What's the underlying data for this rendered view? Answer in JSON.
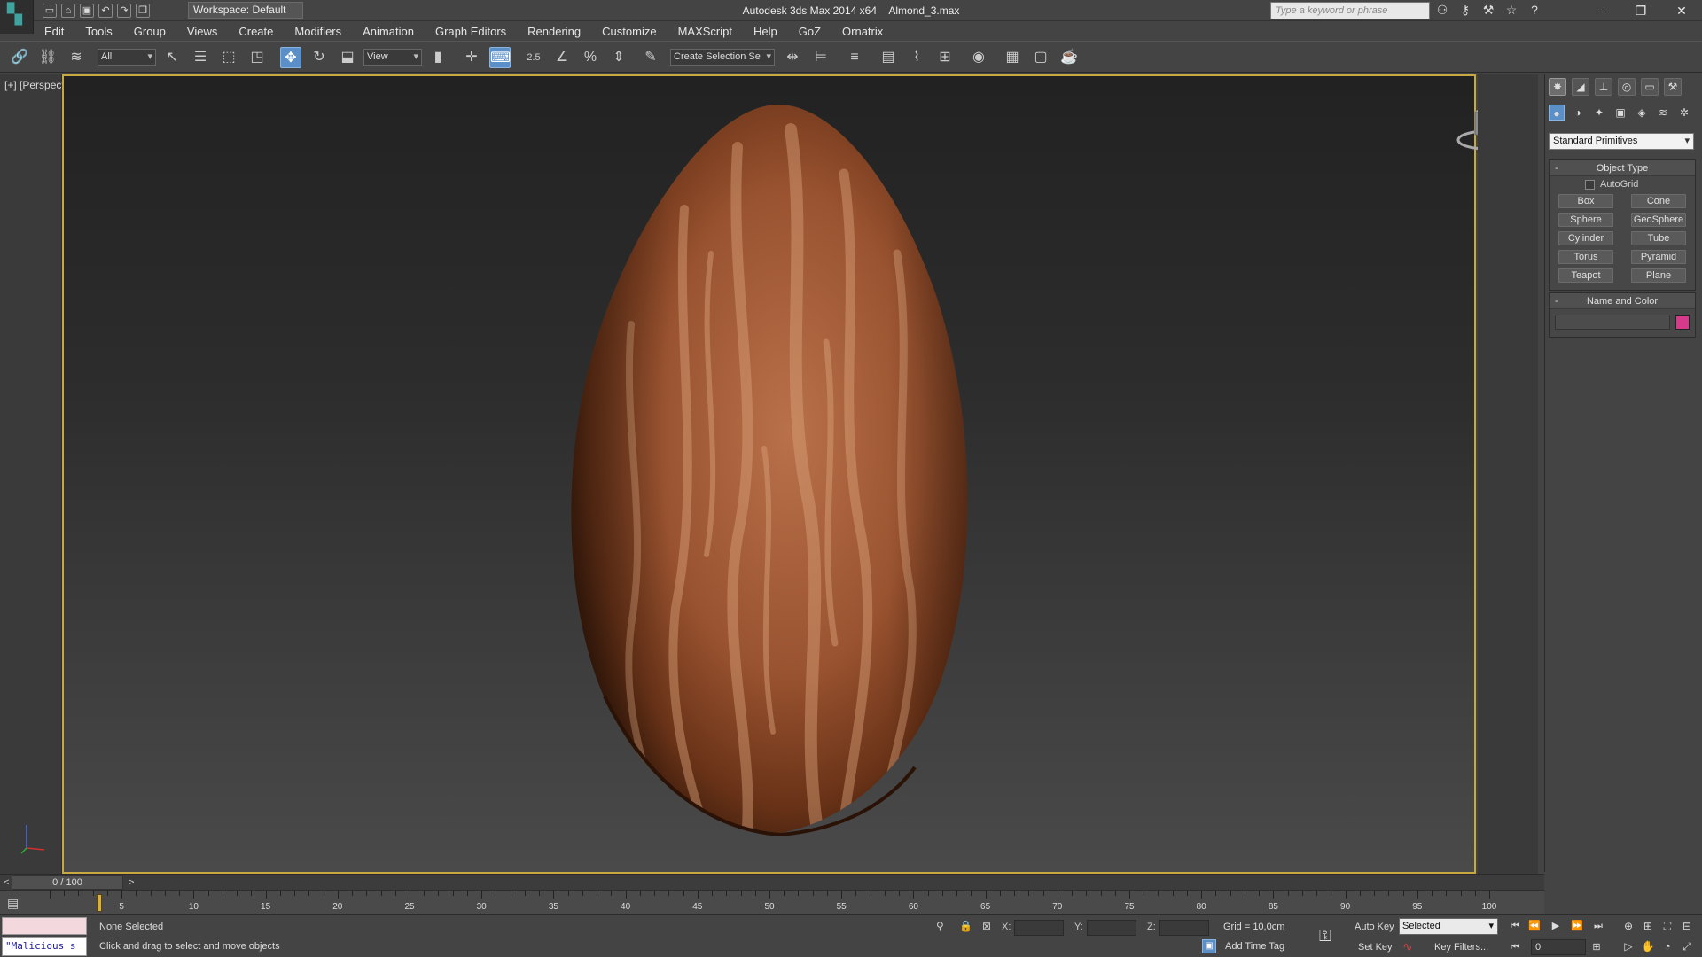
{
  "app": {
    "title": "Autodesk 3ds Max  2014 x64",
    "file": "Almond_3.max",
    "workspace": "Workspace: Default",
    "search_placeholder": "Type a keyword or phrase"
  },
  "menu": [
    "Edit",
    "Tools",
    "Group",
    "Views",
    "Create",
    "Modifiers",
    "Animation",
    "Graph Editors",
    "Rendering",
    "Customize",
    "MAXScript",
    "Help",
    "GoZ",
    "Ornatrix"
  ],
  "toolbar": {
    "filter": "All",
    "ref_coord": "View",
    "snap_label": "2.5",
    "named_selection": "Create Selection Se"
  },
  "viewport": {
    "label": "[+] [Perspective ] [Shaded]"
  },
  "command_panel": {
    "category": "Standard Primitives",
    "object_type_title": "Object Type",
    "autogrid_label": "AutoGrid",
    "primitives": [
      "Box",
      "Cone",
      "Sphere",
      "GeoSphere",
      "Cylinder",
      "Tube",
      "Torus",
      "Pyramid",
      "Teapot",
      "Plane"
    ],
    "name_color_title": "Name and Color",
    "object_color": "#d63a8a"
  },
  "timeline": {
    "slider": "0 / 100",
    "prev": "<",
    "next": ">",
    "labels": [
      "5",
      "10",
      "15",
      "20",
      "25",
      "30",
      "35",
      "40",
      "45",
      "50",
      "55",
      "60",
      "65",
      "70",
      "75",
      "80",
      "85",
      "90",
      "95",
      "100"
    ]
  },
  "status": {
    "maxscript_text": "\"Malicious s",
    "selection": "None Selected",
    "prompt": "Click and drag to select and move objects",
    "x_label": "X:",
    "y_label": "Y:",
    "z_label": "Z:",
    "grid": "Grid = 10,0cm",
    "add_time_tag": "Add Time Tag",
    "auto_key": "Auto Key",
    "set_key": "Set Key",
    "key_mode": "Selected",
    "key_filters": "Key Filters...",
    "current_frame": "0"
  },
  "colors": {
    "accent": "#5b8fc7",
    "viewport_border": "#c8a840",
    "almond_base": "#9a5330"
  }
}
